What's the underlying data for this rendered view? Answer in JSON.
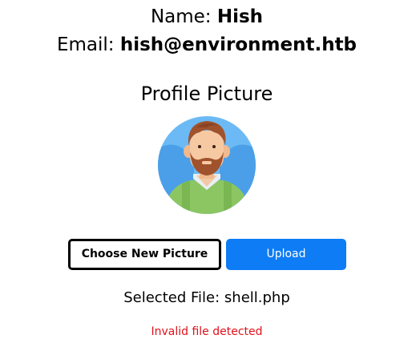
{
  "profile": {
    "name_label": "Name:",
    "name_value": "Hish",
    "email_label": "Email:",
    "email_value": "hish@environment.htb",
    "picture_heading": "Profile Picture",
    "avatar_icon": "user-avatar-icon"
  },
  "upload": {
    "choose_label": "Choose New Picture",
    "upload_label": "Upload",
    "selected_label": "Selected File:",
    "selected_file": "shell.php",
    "error_message": "Invalid file detected"
  },
  "colors": {
    "upload_button": "#0d7cf5",
    "error_text": "#e0101a",
    "avatar_background": "#5bb0f0",
    "avatar_shirt": "#8cc663"
  }
}
